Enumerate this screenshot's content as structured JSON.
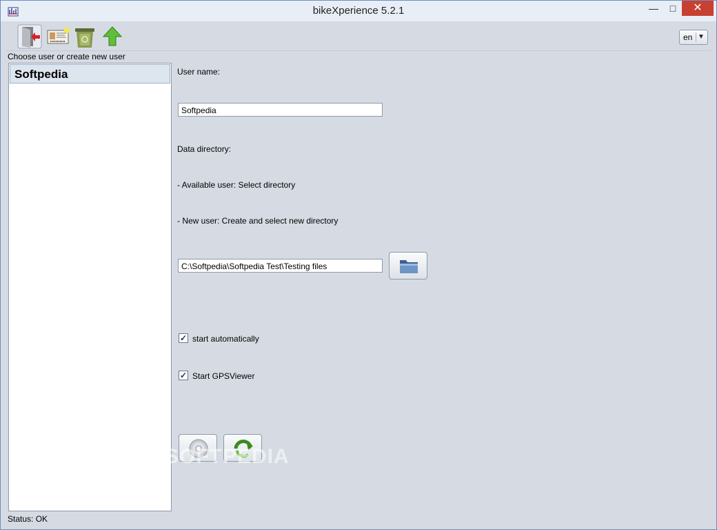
{
  "window": {
    "title": "bikeXperience 5.2.1"
  },
  "toolbar": {
    "buttons": [
      {
        "icon": "exit-door-icon"
      },
      {
        "icon": "user-card-icon"
      },
      {
        "icon": "recycle-bin-icon"
      },
      {
        "icon": "up-arrow-icon"
      }
    ],
    "language": "en"
  },
  "users": {
    "heading": "Choose user or create new user",
    "items": [
      "Softpedia"
    ]
  },
  "form": {
    "user_name_label": "User name:",
    "user_name_value": "Softpedia",
    "data_directory_label": "Data directory:",
    "hint_available": "- Available user: Select directory",
    "hint_new": "- New user: Create and select new directory",
    "directory_value": "C:\\Softpedia\\Softpedia Test\\Testing files",
    "start_automatically": {
      "label": "start automatically",
      "checked": true
    },
    "start_gpsviewer": {
      "label": "Start GPSViewer",
      "checked": true
    }
  },
  "status": "Status: OK",
  "watermark": "SOFTPEDIA",
  "colors": {
    "accent": "#3a8a1e",
    "close": "#c84031",
    "border": "#6a8fc1"
  }
}
